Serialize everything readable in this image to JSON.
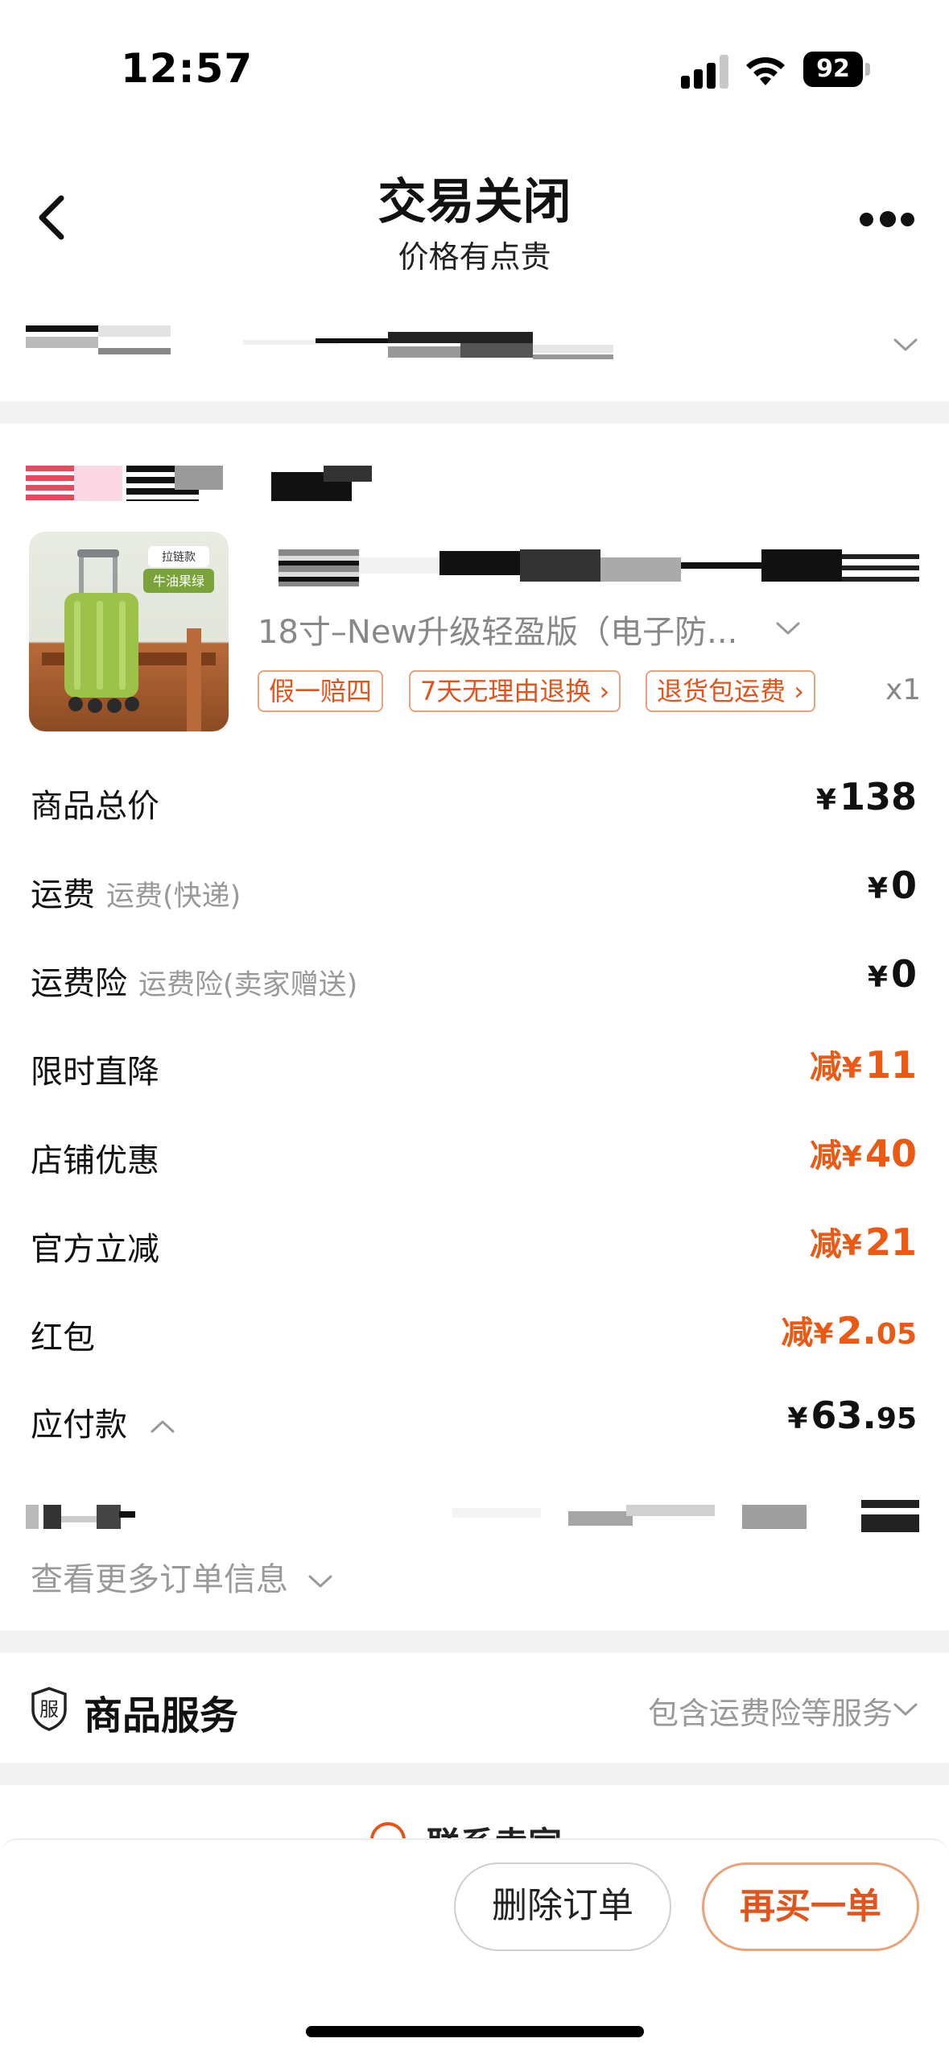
{
  "status_bar": {
    "time": "12:57",
    "battery": "92"
  },
  "header": {
    "title": "交易关闭",
    "subtitle": "价格有点贵"
  },
  "product": {
    "thumb_badge_top": "拉链款",
    "thumb_badge_bottom": "牛油果绿",
    "variant": "18寸–New升级轻盈版（电子防...",
    "tags": [
      "假一赔四",
      "7天无理由退换",
      "退货包运费"
    ],
    "quantity": "x1"
  },
  "price_rows": [
    {
      "label": "商品总价",
      "sub": "",
      "prefix": "",
      "yen": "¥",
      "amount": "138",
      "decimal": "",
      "highlight": false
    },
    {
      "label": "运费",
      "sub": "运费(快递)",
      "prefix": "",
      "yen": "¥",
      "amount": "0",
      "decimal": "",
      "highlight": false
    },
    {
      "label": "运费险",
      "sub": "运费险(卖家赠送)",
      "prefix": "",
      "yen": "¥",
      "amount": "0",
      "decimal": "",
      "highlight": false
    },
    {
      "label": "限时直降",
      "sub": "",
      "prefix": "减",
      "yen": "¥",
      "amount": "11",
      "decimal": "",
      "highlight": true
    },
    {
      "label": "店铺优惠",
      "sub": "",
      "prefix": "减",
      "yen": "¥",
      "amount": "40",
      "decimal": "",
      "highlight": true
    },
    {
      "label": "官方立减",
      "sub": "",
      "prefix": "减",
      "yen": "¥",
      "amount": "21",
      "decimal": "",
      "highlight": true
    },
    {
      "label": "红包",
      "sub": "",
      "prefix": "减",
      "yen": "¥",
      "amount": "2.",
      "decimal": "05",
      "highlight": true
    }
  ],
  "payable": {
    "label": "应付款",
    "yen": "¥",
    "amount": "63.",
    "decimal": "95"
  },
  "more_info": "查看更多订单信息",
  "service": {
    "icon_text": "服",
    "title": "商品服务",
    "description": "包含运费险等服务"
  },
  "peek_text": "联系卖家",
  "actions": {
    "delete": "删除订单",
    "rebuy": "再买一单"
  },
  "colors": {
    "accent": "#ea5a14",
    "tag_border": "#e9a27a",
    "muted": "#999999",
    "separator": "#f3f3f3"
  }
}
